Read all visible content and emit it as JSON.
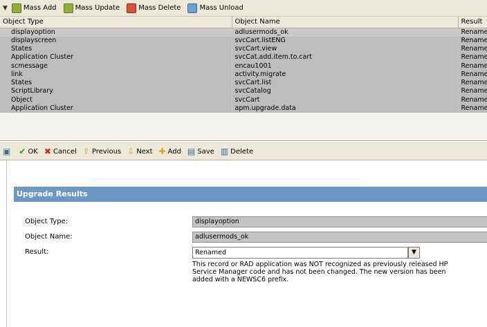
{
  "top_toolbar": {
    "items": [
      {
        "label": "Mass Add"
      },
      {
        "label": "Mass Update"
      },
      {
        "label": "Mass Delete"
      },
      {
        "label": "Mass Unload"
      }
    ]
  },
  "grid": {
    "columns": [
      "Object Type",
      "Object Name",
      "Result"
    ],
    "rows": [
      [
        "displayoption",
        "adlusermods_ok",
        "Rename"
      ],
      [
        "displayscreen",
        "svcCart.listENG",
        "Rename"
      ],
      [
        "States",
        "svcCart.view",
        "Rename"
      ],
      [
        "Application Cluster",
        "svcCat.add.item.to.cart",
        "Rename"
      ],
      [
        "scmessage",
        "encau1001",
        "Rename"
      ],
      [
        "link",
        "activity.migrate",
        "Rename"
      ],
      [
        "States",
        "svcCart.list",
        "Rename"
      ],
      [
        "ScriptLibrary",
        "svcCatalog",
        "Rename"
      ],
      [
        "Object",
        "svcCart",
        "Rename"
      ],
      [
        "Application Cluster",
        "apm.upgrade.data",
        "Rename"
      ]
    ]
  },
  "action_toolbar": {
    "ok": "OK",
    "cancel": "Cancel",
    "previous": "Previous",
    "next": "Next",
    "add": "Add",
    "save": "Save",
    "delete": "Delete"
  },
  "form": {
    "section_title": "Upgrade Results",
    "object_type_label": "Object Type:",
    "object_type_value": "displayoption",
    "object_name_label": "Object Name:",
    "object_name_value": "adlusermods_ok",
    "result_label": "Result:",
    "result_value": "Renamed",
    "note_line1": "This record or RAD application was NOT recognized as previously released HP",
    "note_line2": "Service Manager code and has not been changed.  The new version has been",
    "note_line3": "added with a NEWSC6 prefix."
  }
}
